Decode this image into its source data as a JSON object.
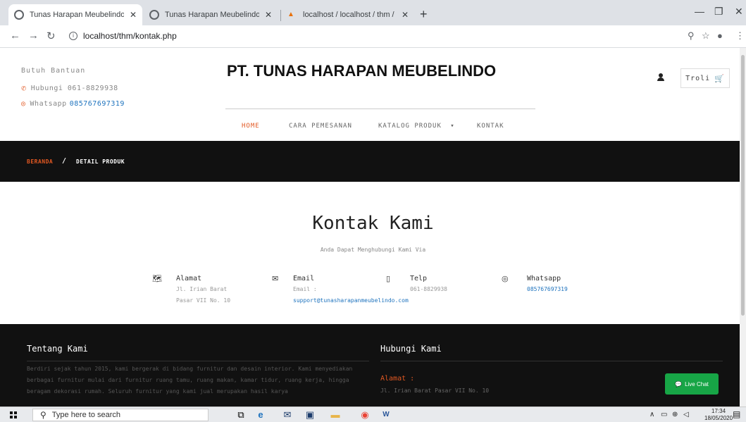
{
  "browser": {
    "tabs": [
      {
        "title": "Tunas Harapan Meubelindo",
        "active": true
      },
      {
        "title": "Tunas Harapan Meubelindo",
        "active": false
      },
      {
        "title": "localhost / localhost / thm / surv",
        "active": false
      }
    ],
    "new_tab": "+",
    "url": "localhost/thm/kontak.php",
    "window_controls": [
      "minimize",
      "restore",
      "close"
    ]
  },
  "header": {
    "help_label": "Butuh Bantuan",
    "phone": "Hubungi 061-8829938",
    "whatsapp_label": "Whatsapp",
    "whatsapp_number": "085767697319",
    "brand": "PT. TUNAS HARAPAN MEUBELINDO",
    "cart_label": "Troli"
  },
  "menu": {
    "items": [
      {
        "label": "HOME",
        "active": true
      },
      {
        "label": "CARA PEMESANAN",
        "active": false
      },
      {
        "label": "KATALOG PRODUK",
        "active": false,
        "dropdown": true
      },
      {
        "label": "KONTAK",
        "active": false
      }
    ]
  },
  "breadcrumb": {
    "home": "BERANDA",
    "separator": "/",
    "current": "DETAIL PRODUK"
  },
  "contact": {
    "title": "Kontak Kami",
    "subtitle": "Anda Dapat Menghubungi Kami Via",
    "alamat": {
      "label": "Alamat",
      "line1": "Jl. Irian Barat",
      "line2": "Pasar VII No. 10"
    },
    "email": {
      "label": "Email",
      "line1": "Email :",
      "link": "support@tunasharapanmeubelindo.com"
    },
    "telp": {
      "label": "Telp",
      "line1": "061-8829938"
    },
    "whatsapp": {
      "label": "Whatsapp",
      "link": "085767697319"
    }
  },
  "footer": {
    "about_title": "Tentang Kami",
    "about_text": "Berdiri sejak tahun 2015, kami bergerak di bidang furnitur dan desain interior. Kami menyediakan berbagai furnitur mulai dari furnitur ruang tamu, ruang makan, kamar tidur, ruang kerja, hingga beragam dekorasi rumah. Seluruh furnitur yang kami jual merupakan hasil karya",
    "contact_title": "Hubungi Kami",
    "alamat_label": "Alamat :",
    "alamat_value": "Jl. Irian Barat Pasar VII No. 10",
    "live_chat": "Live Chat"
  },
  "taskbar": {
    "search_placeholder": "Type here to search",
    "time": "17:34",
    "date": "18/05/2020"
  },
  "colors": {
    "accent": "#e25822",
    "link": "#1e73be",
    "dark": "#111111",
    "live_chat": "#17a546"
  }
}
